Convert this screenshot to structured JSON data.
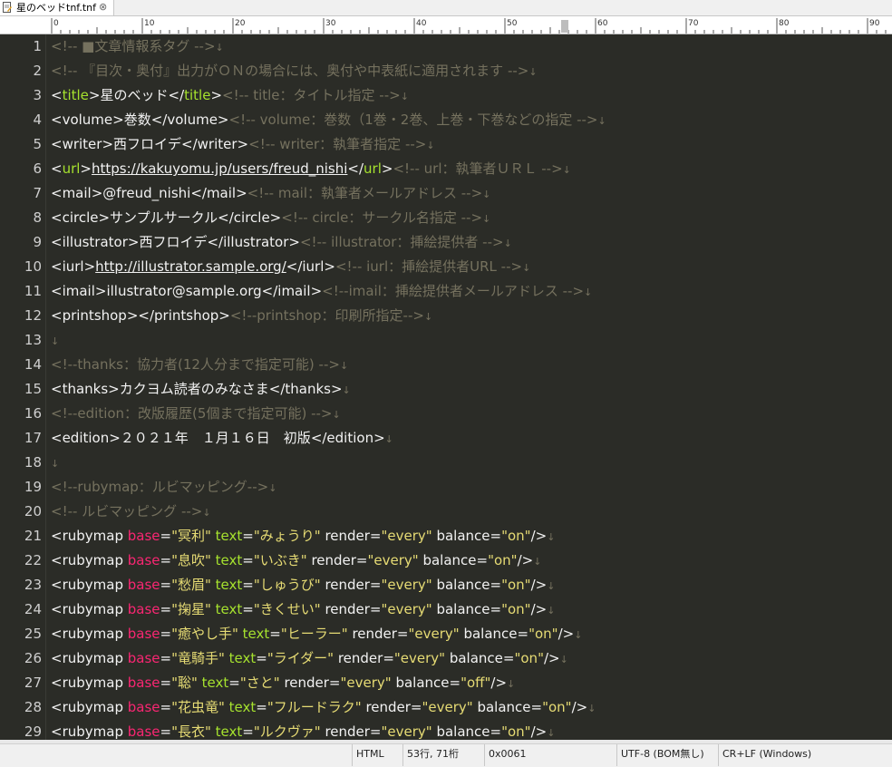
{
  "tab": {
    "filename": "星のベッドtnf.tnf",
    "icon": "document-edit-icon",
    "close_glyph": "⊗"
  },
  "ruler": {
    "labels": [
      "0",
      "10",
      "20",
      "30",
      "40",
      "50",
      "60",
      "70",
      "80",
      "90"
    ]
  },
  "editor": {
    "lines": [
      {
        "n": "1",
        "tokens": [
          {
            "c": "com",
            "t": "<!-- ■文章情報系タグ -->"
          }
        ]
      },
      {
        "n": "2",
        "tokens": [
          {
            "c": "com",
            "t": "<!-- 『目次・奥付』出力がＯＮの場合には、奥付や中表紙に適用されます -->"
          }
        ]
      },
      {
        "n": "3",
        "tokens": [
          {
            "c": "tag",
            "t": "<"
          },
          {
            "c": "kw",
            "t": "title"
          },
          {
            "c": "tag",
            "t": ">"
          },
          {
            "c": "text",
            "t": "星のベッド"
          },
          {
            "c": "tag",
            "t": "</"
          },
          {
            "c": "kw",
            "t": "title"
          },
          {
            "c": "tag",
            "t": ">"
          },
          {
            "c": "com",
            "t": "<!-- title：タイトル指定 -->"
          }
        ]
      },
      {
        "n": "4",
        "tokens": [
          {
            "c": "tag",
            "t": "<volume>"
          },
          {
            "c": "text",
            "t": "巻数"
          },
          {
            "c": "tag",
            "t": "</volume>"
          },
          {
            "c": "com",
            "t": "<!-- volume：巻数（1巻・2巻、上巻・下巻などの指定 -->"
          }
        ]
      },
      {
        "n": "5",
        "tokens": [
          {
            "c": "tag",
            "t": "<writer>"
          },
          {
            "c": "text",
            "t": "西フロイデ"
          },
          {
            "c": "tag",
            "t": "</writer>"
          },
          {
            "c": "com",
            "t": "<!-- writer：執筆者指定 -->"
          }
        ]
      },
      {
        "n": "6",
        "tokens": [
          {
            "c": "tag",
            "t": "<"
          },
          {
            "c": "kw",
            "t": "url"
          },
          {
            "c": "tag",
            "t": ">"
          },
          {
            "c": "link",
            "t": "https://kakuyomu.jp/users/freud_nishi"
          },
          {
            "c": "tag",
            "t": "</"
          },
          {
            "c": "kw",
            "t": "url"
          },
          {
            "c": "tag",
            "t": ">"
          },
          {
            "c": "com",
            "t": "<!-- url：執筆者ＵＲＬ -->"
          }
        ]
      },
      {
        "n": "7",
        "tokens": [
          {
            "c": "tag",
            "t": "<mail>"
          },
          {
            "c": "text",
            "t": "@freud_nishi"
          },
          {
            "c": "tag",
            "t": "</mail>"
          },
          {
            "c": "com",
            "t": "<!-- mail：執筆者メールアドレス -->"
          }
        ]
      },
      {
        "n": "8",
        "tokens": [
          {
            "c": "tag",
            "t": "<circle>"
          },
          {
            "c": "text",
            "t": "サンプルサークル"
          },
          {
            "c": "tag",
            "t": "</circle>"
          },
          {
            "c": "com",
            "t": "<!-- circle：サークル名指定 -->"
          }
        ]
      },
      {
        "n": "9",
        "tokens": [
          {
            "c": "tag",
            "t": "<illustrator>"
          },
          {
            "c": "text",
            "t": "西フロイデ"
          },
          {
            "c": "tag",
            "t": "</illustrator>"
          },
          {
            "c": "com",
            "t": "<!-- illustrator：挿絵提供者 -->"
          }
        ]
      },
      {
        "n": "10",
        "tokens": [
          {
            "c": "tag",
            "t": "<iurl>"
          },
          {
            "c": "link",
            "t": "http://illustrator.sample.org/"
          },
          {
            "c": "tag",
            "t": "</iurl>"
          },
          {
            "c": "com",
            "t": "<!-- iurl：挿絵提供者URL -->"
          }
        ]
      },
      {
        "n": "11",
        "tokens": [
          {
            "c": "tag",
            "t": "<imail>"
          },
          {
            "c": "text",
            "t": "illustrator@sample.org"
          },
          {
            "c": "tag",
            "t": "</imail>"
          },
          {
            "c": "com",
            "t": "<!--imail：挿絵提供者メールアドレス -->"
          }
        ]
      },
      {
        "n": "12",
        "tokens": [
          {
            "c": "tag",
            "t": "<printshop></printshop>"
          },
          {
            "c": "com",
            "t": "<!--printshop：印刷所指定-->"
          }
        ]
      },
      {
        "n": "13",
        "tokens": []
      },
      {
        "n": "14",
        "tokens": [
          {
            "c": "com",
            "t": "<!--thanks：協力者(12人分まで指定可能) -->"
          }
        ]
      },
      {
        "n": "15",
        "tokens": [
          {
            "c": "tag",
            "t": "<thanks>"
          },
          {
            "c": "text",
            "t": "カクヨム読者のみなさま"
          },
          {
            "c": "tag",
            "t": "</thanks>"
          }
        ]
      },
      {
        "n": "16",
        "tokens": [
          {
            "c": "com",
            "t": "<!--edition：改版履歴(5個まで指定可能) -->"
          }
        ]
      },
      {
        "n": "17",
        "tokens": [
          {
            "c": "tag",
            "t": "<edition>"
          },
          {
            "c": "text",
            "t": "２０２１年　１月１６日　初版"
          },
          {
            "c": "tag",
            "t": "</edition>"
          }
        ]
      },
      {
        "n": "18",
        "tokens": []
      },
      {
        "n": "19",
        "tokens": [
          {
            "c": "com",
            "t": "<!--rubymap：ルビマッピング-->"
          }
        ]
      },
      {
        "n": "20",
        "tokens": [
          {
            "c": "com",
            "t": "<!-- ルビマッピング -->"
          }
        ]
      },
      {
        "n": "21",
        "tokens": [
          {
            "c": "tag",
            "t": "<rubymap "
          },
          {
            "c": "attr",
            "t": "base"
          },
          {
            "c": "tag",
            "t": "="
          },
          {
            "c": "str",
            "t": "\"冥利\""
          },
          {
            "c": "tag",
            "t": " "
          },
          {
            "c": "kw",
            "t": "text"
          },
          {
            "c": "tag",
            "t": "="
          },
          {
            "c": "str",
            "t": "\"みょうり\""
          },
          {
            "c": "tag",
            "t": " render="
          },
          {
            "c": "str",
            "t": "\"every\""
          },
          {
            "c": "tag",
            "t": " balance="
          },
          {
            "c": "str",
            "t": "\"on\""
          },
          {
            "c": "tag",
            "t": "/>"
          }
        ]
      },
      {
        "n": "22",
        "tokens": [
          {
            "c": "tag",
            "t": "<rubymap "
          },
          {
            "c": "attr",
            "t": "base"
          },
          {
            "c": "tag",
            "t": "="
          },
          {
            "c": "str",
            "t": "\"息吹\""
          },
          {
            "c": "tag",
            "t": " "
          },
          {
            "c": "kw",
            "t": "text"
          },
          {
            "c": "tag",
            "t": "="
          },
          {
            "c": "str",
            "t": "\"いぶき\""
          },
          {
            "c": "tag",
            "t": " render="
          },
          {
            "c": "str",
            "t": "\"every\""
          },
          {
            "c": "tag",
            "t": " balance="
          },
          {
            "c": "str",
            "t": "\"on\""
          },
          {
            "c": "tag",
            "t": "/>"
          }
        ]
      },
      {
        "n": "23",
        "tokens": [
          {
            "c": "tag",
            "t": "<rubymap "
          },
          {
            "c": "attr",
            "t": "base"
          },
          {
            "c": "tag",
            "t": "="
          },
          {
            "c": "str",
            "t": "\"愁眉\""
          },
          {
            "c": "tag",
            "t": " "
          },
          {
            "c": "kw",
            "t": "text"
          },
          {
            "c": "tag",
            "t": "="
          },
          {
            "c": "str",
            "t": "\"しゅうび\""
          },
          {
            "c": "tag",
            "t": " render="
          },
          {
            "c": "str",
            "t": "\"every\""
          },
          {
            "c": "tag",
            "t": " balance="
          },
          {
            "c": "str",
            "t": "\"on\""
          },
          {
            "c": "tag",
            "t": "/>"
          }
        ]
      },
      {
        "n": "24",
        "tokens": [
          {
            "c": "tag",
            "t": "<rubymap "
          },
          {
            "c": "attr",
            "t": "base"
          },
          {
            "c": "tag",
            "t": "="
          },
          {
            "c": "str",
            "t": "\"掬星\""
          },
          {
            "c": "tag",
            "t": " "
          },
          {
            "c": "kw",
            "t": "text"
          },
          {
            "c": "tag",
            "t": "="
          },
          {
            "c": "str",
            "t": "\"きくせい\""
          },
          {
            "c": "tag",
            "t": " render="
          },
          {
            "c": "str",
            "t": "\"every\""
          },
          {
            "c": "tag",
            "t": " balance="
          },
          {
            "c": "str",
            "t": "\"on\""
          },
          {
            "c": "tag",
            "t": "/>"
          }
        ]
      },
      {
        "n": "25",
        "tokens": [
          {
            "c": "tag",
            "t": "<rubymap "
          },
          {
            "c": "attr",
            "t": "base"
          },
          {
            "c": "tag",
            "t": "="
          },
          {
            "c": "str",
            "t": "\"癒やし手\""
          },
          {
            "c": "tag",
            "t": " "
          },
          {
            "c": "kw",
            "t": "text"
          },
          {
            "c": "tag",
            "t": "="
          },
          {
            "c": "str",
            "t": "\"ヒーラー\""
          },
          {
            "c": "tag",
            "t": " render="
          },
          {
            "c": "str",
            "t": "\"every\""
          },
          {
            "c": "tag",
            "t": " balance="
          },
          {
            "c": "str",
            "t": "\"on\""
          },
          {
            "c": "tag",
            "t": "/>"
          }
        ]
      },
      {
        "n": "26",
        "tokens": [
          {
            "c": "tag",
            "t": "<rubymap "
          },
          {
            "c": "attr",
            "t": "base"
          },
          {
            "c": "tag",
            "t": "="
          },
          {
            "c": "str",
            "t": "\"竜騎手\""
          },
          {
            "c": "tag",
            "t": " "
          },
          {
            "c": "kw",
            "t": "text"
          },
          {
            "c": "tag",
            "t": "="
          },
          {
            "c": "str",
            "t": "\"ライダー\""
          },
          {
            "c": "tag",
            "t": " render="
          },
          {
            "c": "str",
            "t": "\"every\""
          },
          {
            "c": "tag",
            "t": " balance="
          },
          {
            "c": "str",
            "t": "\"on\""
          },
          {
            "c": "tag",
            "t": "/>"
          }
        ]
      },
      {
        "n": "27",
        "tokens": [
          {
            "c": "tag",
            "t": "<rubymap "
          },
          {
            "c": "attr",
            "t": "base"
          },
          {
            "c": "tag",
            "t": "="
          },
          {
            "c": "str",
            "t": "\"聡\""
          },
          {
            "c": "tag",
            "t": " "
          },
          {
            "c": "kw",
            "t": "text"
          },
          {
            "c": "tag",
            "t": "="
          },
          {
            "c": "str",
            "t": "\"さと\""
          },
          {
            "c": "tag",
            "t": " render="
          },
          {
            "c": "str",
            "t": "\"every\""
          },
          {
            "c": "tag",
            "t": " balance="
          },
          {
            "c": "str",
            "t": "\"off\""
          },
          {
            "c": "tag",
            "t": "/>"
          }
        ]
      },
      {
        "n": "28",
        "tokens": [
          {
            "c": "tag",
            "t": "<rubymap "
          },
          {
            "c": "attr",
            "t": "base"
          },
          {
            "c": "tag",
            "t": "="
          },
          {
            "c": "str",
            "t": "\"花虫竜\""
          },
          {
            "c": "tag",
            "t": " "
          },
          {
            "c": "kw",
            "t": "text"
          },
          {
            "c": "tag",
            "t": "="
          },
          {
            "c": "str",
            "t": "\"フルードラク\""
          },
          {
            "c": "tag",
            "t": " render="
          },
          {
            "c": "str",
            "t": "\"every\""
          },
          {
            "c": "tag",
            "t": " balance="
          },
          {
            "c": "str",
            "t": "\"on\""
          },
          {
            "c": "tag",
            "t": "/>"
          }
        ]
      },
      {
        "n": "29",
        "tokens": [
          {
            "c": "tag",
            "t": "<rubymap "
          },
          {
            "c": "attr",
            "t": "base"
          },
          {
            "c": "tag",
            "t": "="
          },
          {
            "c": "str",
            "t": "\"長衣\""
          },
          {
            "c": "tag",
            "t": " "
          },
          {
            "c": "kw",
            "t": "text"
          },
          {
            "c": "tag",
            "t": "="
          },
          {
            "c": "str",
            "t": "\"ルクヴァ\""
          },
          {
            "c": "tag",
            "t": " render="
          },
          {
            "c": "str",
            "t": "\"every\""
          },
          {
            "c": "tag",
            "t": " balance="
          },
          {
            "c": "str",
            "t": "\"on\""
          },
          {
            "c": "tag",
            "t": "/>"
          }
        ]
      }
    ],
    "eol_glyph": "↓"
  },
  "status": {
    "mode": "HTML",
    "position": "53行, 71桁",
    "char_code": "0x0061",
    "encoding": "UTF-8 (BOM無し)",
    "line_ending": "CR+LF (Windows)"
  },
  "colors": {
    "background": "#2b2c27",
    "comment": "#75715e",
    "keyword": "#a6e22e",
    "attribute": "#f92672",
    "string": "#e6db74",
    "text": "#f2f2f2"
  }
}
